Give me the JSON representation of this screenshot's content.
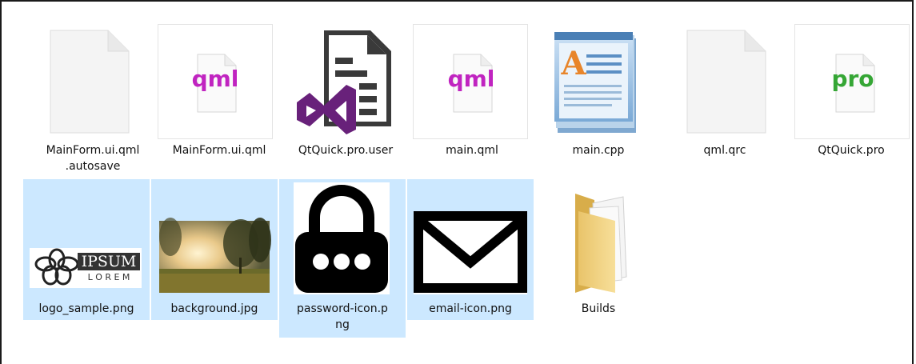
{
  "files": [
    {
      "name": "MainForm.ui.qml\n.autosave",
      "icon": "blank-file-icon"
    },
    {
      "name": "MainForm.ui.qml",
      "icon": "qml-file-icon",
      "badge": "qml"
    },
    {
      "name": "QtQuick.pro.user",
      "icon": "visual-studio-file-icon"
    },
    {
      "name": "main.qml",
      "icon": "qml-file-icon",
      "badge": "qml"
    },
    {
      "name": "main.cpp",
      "icon": "wordpad-document-icon",
      "badge": "A"
    },
    {
      "name": "qml.qrc",
      "icon": "blank-file-icon"
    },
    {
      "name": "QtQuick.pro",
      "icon": "pro-file-icon",
      "badge": "pro"
    },
    {
      "name": "logo_sample.png",
      "icon": "logo-thumbnail",
      "logo_text_1": "IPSUM",
      "logo_text_2": "L O R E M"
    },
    {
      "name": "background.jpg",
      "icon": "sunset-photo-thumbnail"
    },
    {
      "name": "password-icon.p\nng",
      "icon": "padlock-icon"
    },
    {
      "name": "email-icon.png",
      "icon": "envelope-icon"
    },
    {
      "name": "Builds",
      "icon": "folder-icon"
    }
  ],
  "colors": {
    "selection": "#cce8ff",
    "qml_badge": "#c024c0",
    "pro_badge": "#35a635",
    "vs_purple": "#68217a"
  }
}
